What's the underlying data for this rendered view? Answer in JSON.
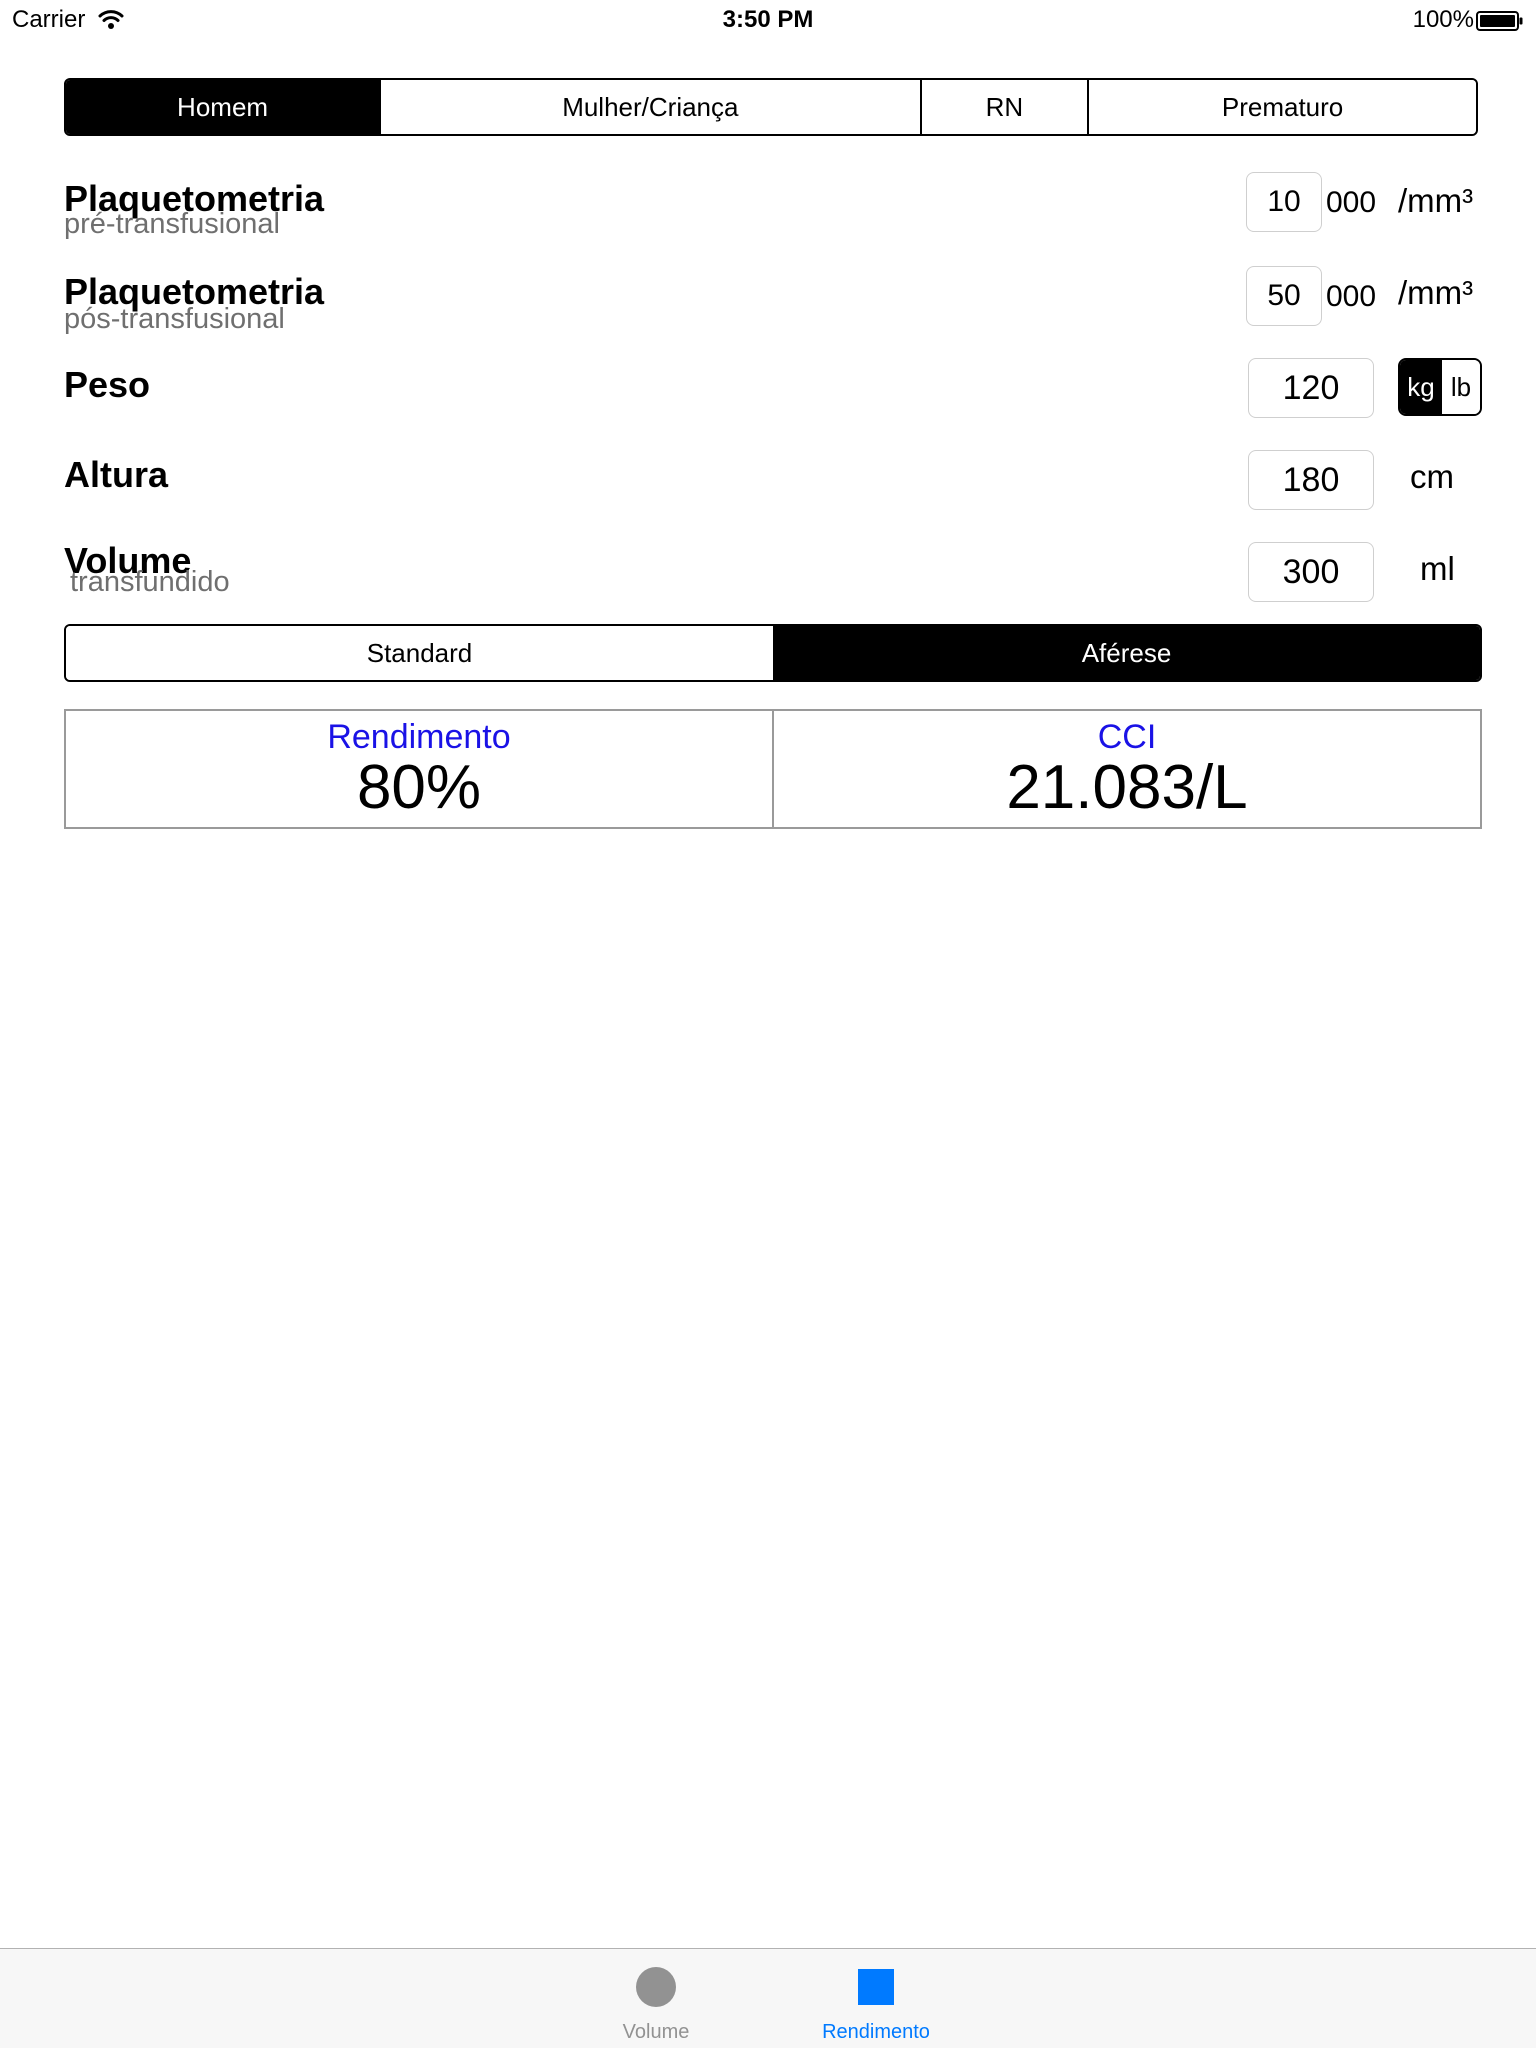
{
  "status_bar": {
    "carrier": "Carrier",
    "time": "3:50 PM",
    "battery": "100%"
  },
  "patient_types": {
    "items": [
      "Homem",
      "Mulher/Criança",
      "RN",
      "Prematuro"
    ],
    "selected": "Homem"
  },
  "fields": {
    "plaq_pre": {
      "label": "Plaquetometria",
      "sublabel": "pré-transfusional",
      "value": "10",
      "suffix": "000",
      "unit": "/mm³"
    },
    "plaq_pos": {
      "label": "Plaquetometria",
      "sublabel": "pós-transfusional",
      "value": "50",
      "suffix": "000",
      "unit": "/mm³"
    },
    "peso": {
      "label": "Peso",
      "value": "120",
      "units": [
        "kg",
        "lb"
      ],
      "selected_unit": "kg"
    },
    "altura": {
      "label": "Altura",
      "value": "180",
      "unit": "cm"
    },
    "volume": {
      "label": "Volume",
      "sublabel": "transfundido",
      "value": "300",
      "unit": "ml"
    }
  },
  "product_type": {
    "items": [
      "Standard",
      "Aférese"
    ],
    "selected": "Aférese"
  },
  "results": {
    "rendimento": {
      "title": "Rendimento",
      "value": "80%"
    },
    "cci": {
      "title": "CCI",
      "value": "21.083/L"
    }
  },
  "tab_bar": {
    "tabs": [
      {
        "label": "Volume",
        "icon": "circle-icon",
        "active": false
      },
      {
        "label": "Rendimento",
        "icon": "square-icon",
        "active": true
      }
    ],
    "active_color": "#007aff",
    "inactive_color": "#929292"
  }
}
